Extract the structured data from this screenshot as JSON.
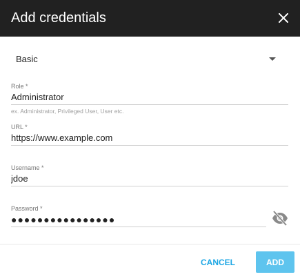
{
  "dialog": {
    "title": "Add credentials",
    "close_icon": "close-icon"
  },
  "auth_type": {
    "selected": "Basic",
    "arrow_icon": "dropdown-arrow-icon"
  },
  "fields": {
    "role": {
      "label": "Role *",
      "value": "Administrator",
      "hint": "ex. Administrator, Privileged User, User etc."
    },
    "url": {
      "label": "URL *",
      "value": "https://www.example.com"
    },
    "username": {
      "label": "Username *",
      "value": "jdoe"
    },
    "password": {
      "label": "Password *",
      "value": "●●●●●●●●●●●●●●●●",
      "toggle_icon": "eye-off-icon"
    }
  },
  "actions": {
    "cancel": "CANCEL",
    "add": "ADD"
  },
  "colors": {
    "header_bg": "#212121",
    "accent": "#1ea7e4",
    "add_button_bg": "#5ec4ee"
  }
}
